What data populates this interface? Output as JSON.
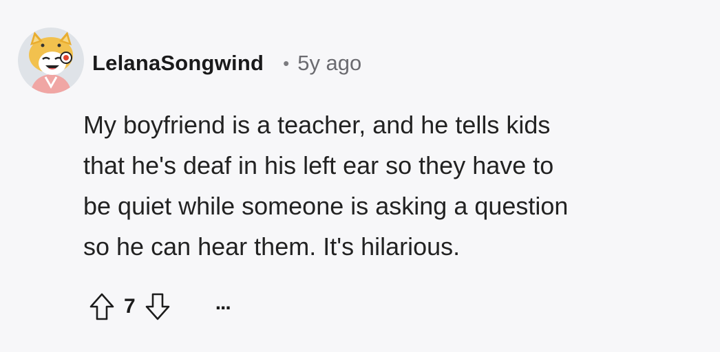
{
  "comment": {
    "author": "LelanaSongwind",
    "separator": "•",
    "time_ago": "5y ago",
    "body": "My boyfriend is a teacher, and he tells kids\nthat he's deaf in his left ear so they have to\nbe quiet while someone is asking a question\nso he can hear them. It's hilarious.",
    "score": "7",
    "more_label": "..."
  },
  "icons": {
    "upvote": "upvote-arrow-icon",
    "downvote": "downvote-arrow-icon",
    "more": "more-options-icon"
  },
  "colors": {
    "background": "#f7f7f9",
    "text": "#1c1c1c",
    "meta": "#6b6b70"
  }
}
